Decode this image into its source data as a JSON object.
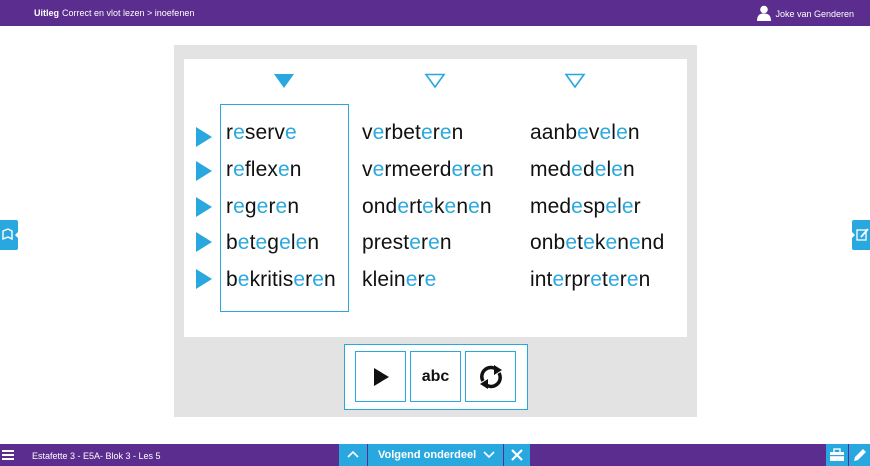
{
  "topbar": {
    "crumb_main": "Uitleg",
    "crumb_sub": "Correct en vlot lezen > inoefenen",
    "user_name": "Joke van Genderen"
  },
  "columns": [
    {
      "words": [
        [
          [
            "r",
            ""
          ],
          [
            "e",
            "b"
          ],
          [
            "serv",
            ""
          ],
          [
            "e",
            "b"
          ]
        ],
        [
          [
            "r",
            ""
          ],
          [
            "e",
            "b"
          ],
          [
            "flex",
            ""
          ],
          [
            "e",
            "b"
          ],
          [
            "n",
            ""
          ]
        ],
        [
          [
            "r",
            ""
          ],
          [
            "e",
            "b"
          ],
          [
            "g",
            ""
          ],
          [
            "e",
            "b"
          ],
          [
            "r",
            ""
          ],
          [
            "e",
            "b"
          ],
          [
            "n",
            ""
          ]
        ],
        [
          [
            "b",
            ""
          ],
          [
            "e",
            "b"
          ],
          [
            "t",
            ""
          ],
          [
            "e",
            "b"
          ],
          [
            "g",
            ""
          ],
          [
            "e",
            "b"
          ],
          [
            "l",
            ""
          ],
          [
            "e",
            "b"
          ],
          [
            "n",
            ""
          ]
        ],
        [
          [
            "b",
            ""
          ],
          [
            "e",
            "b"
          ],
          [
            "kritis",
            ""
          ],
          [
            "e",
            "b"
          ],
          [
            "r",
            ""
          ],
          [
            "e",
            "b"
          ],
          [
            "n",
            ""
          ]
        ]
      ]
    },
    {
      "words": [
        [
          [
            "v",
            ""
          ],
          [
            "e",
            "b"
          ],
          [
            "rbet",
            ""
          ],
          [
            "e",
            "b"
          ],
          [
            "r",
            ""
          ],
          [
            "e",
            "b"
          ],
          [
            "n",
            ""
          ]
        ],
        [
          [
            "v",
            ""
          ],
          [
            "e",
            "b"
          ],
          [
            "rmeerd",
            ""
          ],
          [
            "e",
            "b"
          ],
          [
            "r",
            ""
          ],
          [
            "e",
            "b"
          ],
          [
            "n",
            ""
          ]
        ],
        [
          [
            "ond",
            ""
          ],
          [
            "e",
            "b"
          ],
          [
            "rt",
            ""
          ],
          [
            "e",
            "b"
          ],
          [
            "k",
            ""
          ],
          [
            "e",
            "b"
          ],
          [
            "n",
            ""
          ],
          [
            "e",
            "b"
          ],
          [
            "n",
            ""
          ]
        ],
        [
          [
            "prest",
            ""
          ],
          [
            "e",
            "b"
          ],
          [
            "r",
            ""
          ],
          [
            "e",
            "b"
          ],
          [
            "n",
            ""
          ]
        ],
        [
          [
            "klein",
            ""
          ],
          [
            "e",
            "b"
          ],
          [
            "r",
            ""
          ],
          [
            "e",
            "b"
          ]
        ]
      ]
    },
    {
      "words": [
        [
          [
            "aanb",
            ""
          ],
          [
            "e",
            "b"
          ],
          [
            "v",
            ""
          ],
          [
            "e",
            "b"
          ],
          [
            "l",
            ""
          ],
          [
            "e",
            "b"
          ],
          [
            "n",
            ""
          ]
        ],
        [
          [
            "med",
            ""
          ],
          [
            "e",
            "b"
          ],
          [
            "d",
            ""
          ],
          [
            "e",
            "b"
          ],
          [
            "l",
            ""
          ],
          [
            "e",
            "b"
          ],
          [
            "n",
            ""
          ]
        ],
        [
          [
            "med",
            ""
          ],
          [
            "e",
            "b"
          ],
          [
            "sp",
            ""
          ],
          [
            "e",
            "b"
          ],
          [
            "l",
            ""
          ],
          [
            "e",
            "b"
          ],
          [
            "r",
            ""
          ]
        ],
        [
          [
            "onb",
            ""
          ],
          [
            "e",
            "b"
          ],
          [
            "t",
            ""
          ],
          [
            "e",
            "b"
          ],
          [
            "k",
            ""
          ],
          [
            "e",
            "b"
          ],
          [
            "n",
            ""
          ],
          [
            "e",
            "b"
          ],
          [
            "nd",
            ""
          ]
        ],
        [
          [
            "int",
            ""
          ],
          [
            "e",
            "b"
          ],
          [
            "rpr",
            ""
          ],
          [
            "e",
            "b"
          ],
          [
            "t",
            ""
          ],
          [
            "e",
            "b"
          ],
          [
            "r",
            ""
          ],
          [
            "e",
            "b"
          ],
          [
            "n",
            ""
          ]
        ]
      ]
    }
  ],
  "controls": {
    "play_icon": "play-icon",
    "abc_label": "abc",
    "refresh_icon": "refresh-icon"
  },
  "bottombar": {
    "title": "Estafette 3 - E5A- Blok 3 - Les 5",
    "next_label": "Volgend onderdeel"
  },
  "colors": {
    "purple": "#5b2d8e",
    "accent_blue": "#29a8e0",
    "panel_grey": "#e3e3e3"
  }
}
